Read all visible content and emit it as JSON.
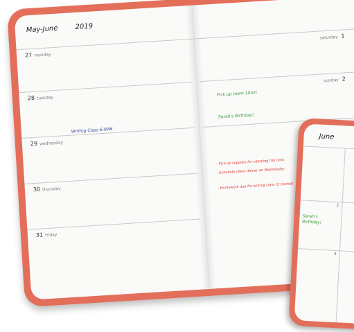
{
  "planner": {
    "month_title": "May-June",
    "year": "2019",
    "left_days": [
      {
        "num": "27",
        "name": "monday"
      },
      {
        "num": "28",
        "name": "tuesday"
      },
      {
        "num": "29",
        "name": "wednesday"
      },
      {
        "num": "30",
        "name": "thursday"
      },
      {
        "num": "31",
        "name": "friday"
      }
    ],
    "right_days": [
      {
        "name": "saturday",
        "num": "1"
      },
      {
        "name": "sunday",
        "num": "2"
      }
    ],
    "notes": {
      "writing_class": "Writing Class 6-9PM",
      "pickup_mom": "Pick up mom 10am",
      "birthday": "Sarah's Birthday!",
      "todo_1": "- Pick up supplies for camping trip next",
      "todo_2": "- Schedule client dinner on Wednesday",
      "todo_3": "- Homework due for writing class (2 stories)"
    }
  },
  "monthly": {
    "title": "June",
    "note": "Sarah's Birthday!",
    "cell_nums": [
      "2",
      "4"
    ]
  },
  "colors": {
    "cover": "#e36f5a",
    "ink_blue": "#2c3f9c",
    "ink_green": "#3d9a3a",
    "ink_red": "#d8342f"
  }
}
